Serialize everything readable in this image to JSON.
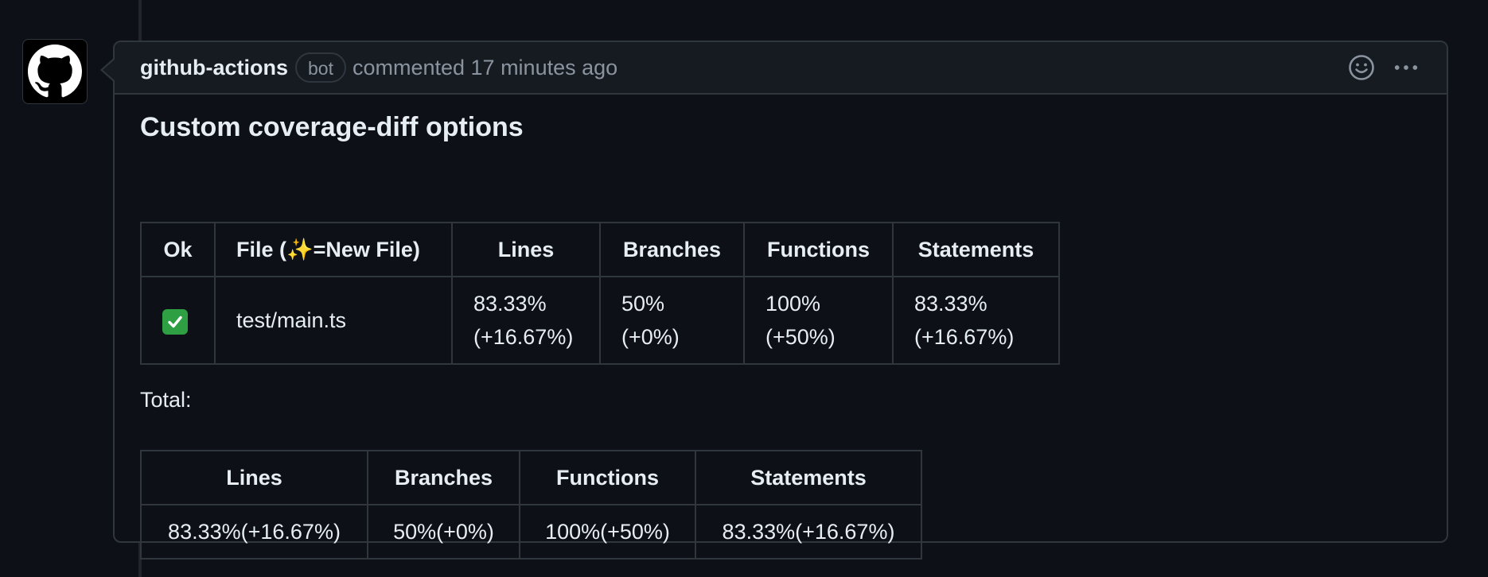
{
  "comment": {
    "author": "github-actions",
    "badge": "bot",
    "meta": "commented 17 minutes ago"
  },
  "icons": {
    "avatar": "github-mark-icon",
    "reaction": "smiley-icon",
    "more": "kebab-horizontal-icon",
    "check": "white-check-mark-icon"
  },
  "body": {
    "title": "Custom coverage-diff options",
    "files_table": {
      "headers": [
        "Ok",
        "File (✨=New File)",
        "Lines",
        "Branches",
        "Functions",
        "Statements"
      ],
      "rows": [
        {
          "ok": "✅",
          "file": "test/main.ts",
          "lines": [
            "83.33%",
            "(+16.67%)"
          ],
          "branches": [
            "50%",
            "(+0%)"
          ],
          "functions": [
            "100%",
            "(+50%)"
          ],
          "statements": [
            "83.33%",
            "(+16.67%)"
          ]
        }
      ]
    },
    "total_label": "Total:",
    "total_table": {
      "headers": [
        "Lines",
        "Branches",
        "Functions",
        "Statements"
      ],
      "values": [
        "83.33%(+16.67%)",
        "50%(+0%)",
        "100%(+50%)",
        "83.33%(+16.67%)"
      ]
    }
  },
  "colors": {
    "background": "#0d1117",
    "header_background": "#161b22",
    "border": "#30363d",
    "text": "#e6edf3",
    "muted": "#8b949e",
    "success": "#2ea043"
  }
}
